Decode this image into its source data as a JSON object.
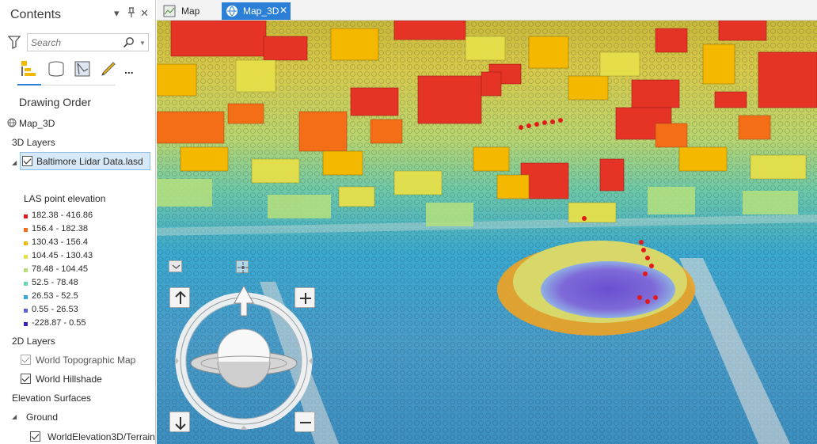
{
  "contents": {
    "title": "Contents",
    "pin_label": "⊽",
    "autohide_label": "⊥",
    "close_label": "✕",
    "search_placeholder": "Search",
    "view_tabs": [
      "list-by-drawing-order-icon",
      "list-by-data-source-icon",
      "list-by-selection-icon",
      "list-by-editing-icon",
      "more-icon"
    ],
    "more_label": "...",
    "drawing_order_label": "Drawing Order",
    "scene_name": "Map_3D",
    "sections": {
      "layers3d": "3D Layers",
      "layers2d": "2D Layers",
      "elevation": "Elevation Surfaces"
    },
    "lidar_layer": "Baltimore Lidar Data.lasd",
    "legend_title": "LAS point elevation",
    "legend": [
      {
        "label": "182.38 - 416.86",
        "color": "#e31a1c"
      },
      {
        "label": "156.4 - 182.38",
        "color": "#f46d17"
      },
      {
        "label": "130.43 - 156.4",
        "color": "#f5b800"
      },
      {
        "label": "104.45 - 130.43",
        "color": "#e6e04b"
      },
      {
        "label": "78.48 - 104.45",
        "color": "#b5e07c"
      },
      {
        "label": "52.5 - 78.48",
        "color": "#63d6b8"
      },
      {
        "label": "26.53 - 52.5",
        "color": "#34a8dc"
      },
      {
        "label": "0.55 - 26.53",
        "color": "#5b5fd6"
      },
      {
        "label": "-228.87 - 0.55",
        "color": "#3d1fc4"
      }
    ],
    "layers2d": [
      "World Topographic Map",
      "World Hillshade"
    ],
    "ground_label": "Ground",
    "terrain_layer": "WorldElevation3D/Terrain"
  },
  "map_tabs": [
    {
      "label": "Map",
      "active": false
    },
    {
      "label": "Map_3D",
      "active": true
    }
  ],
  "map_tab_close": "✕",
  "colors": {
    "accent": "#2b7fd6",
    "selection": "#d7e8f7"
  }
}
